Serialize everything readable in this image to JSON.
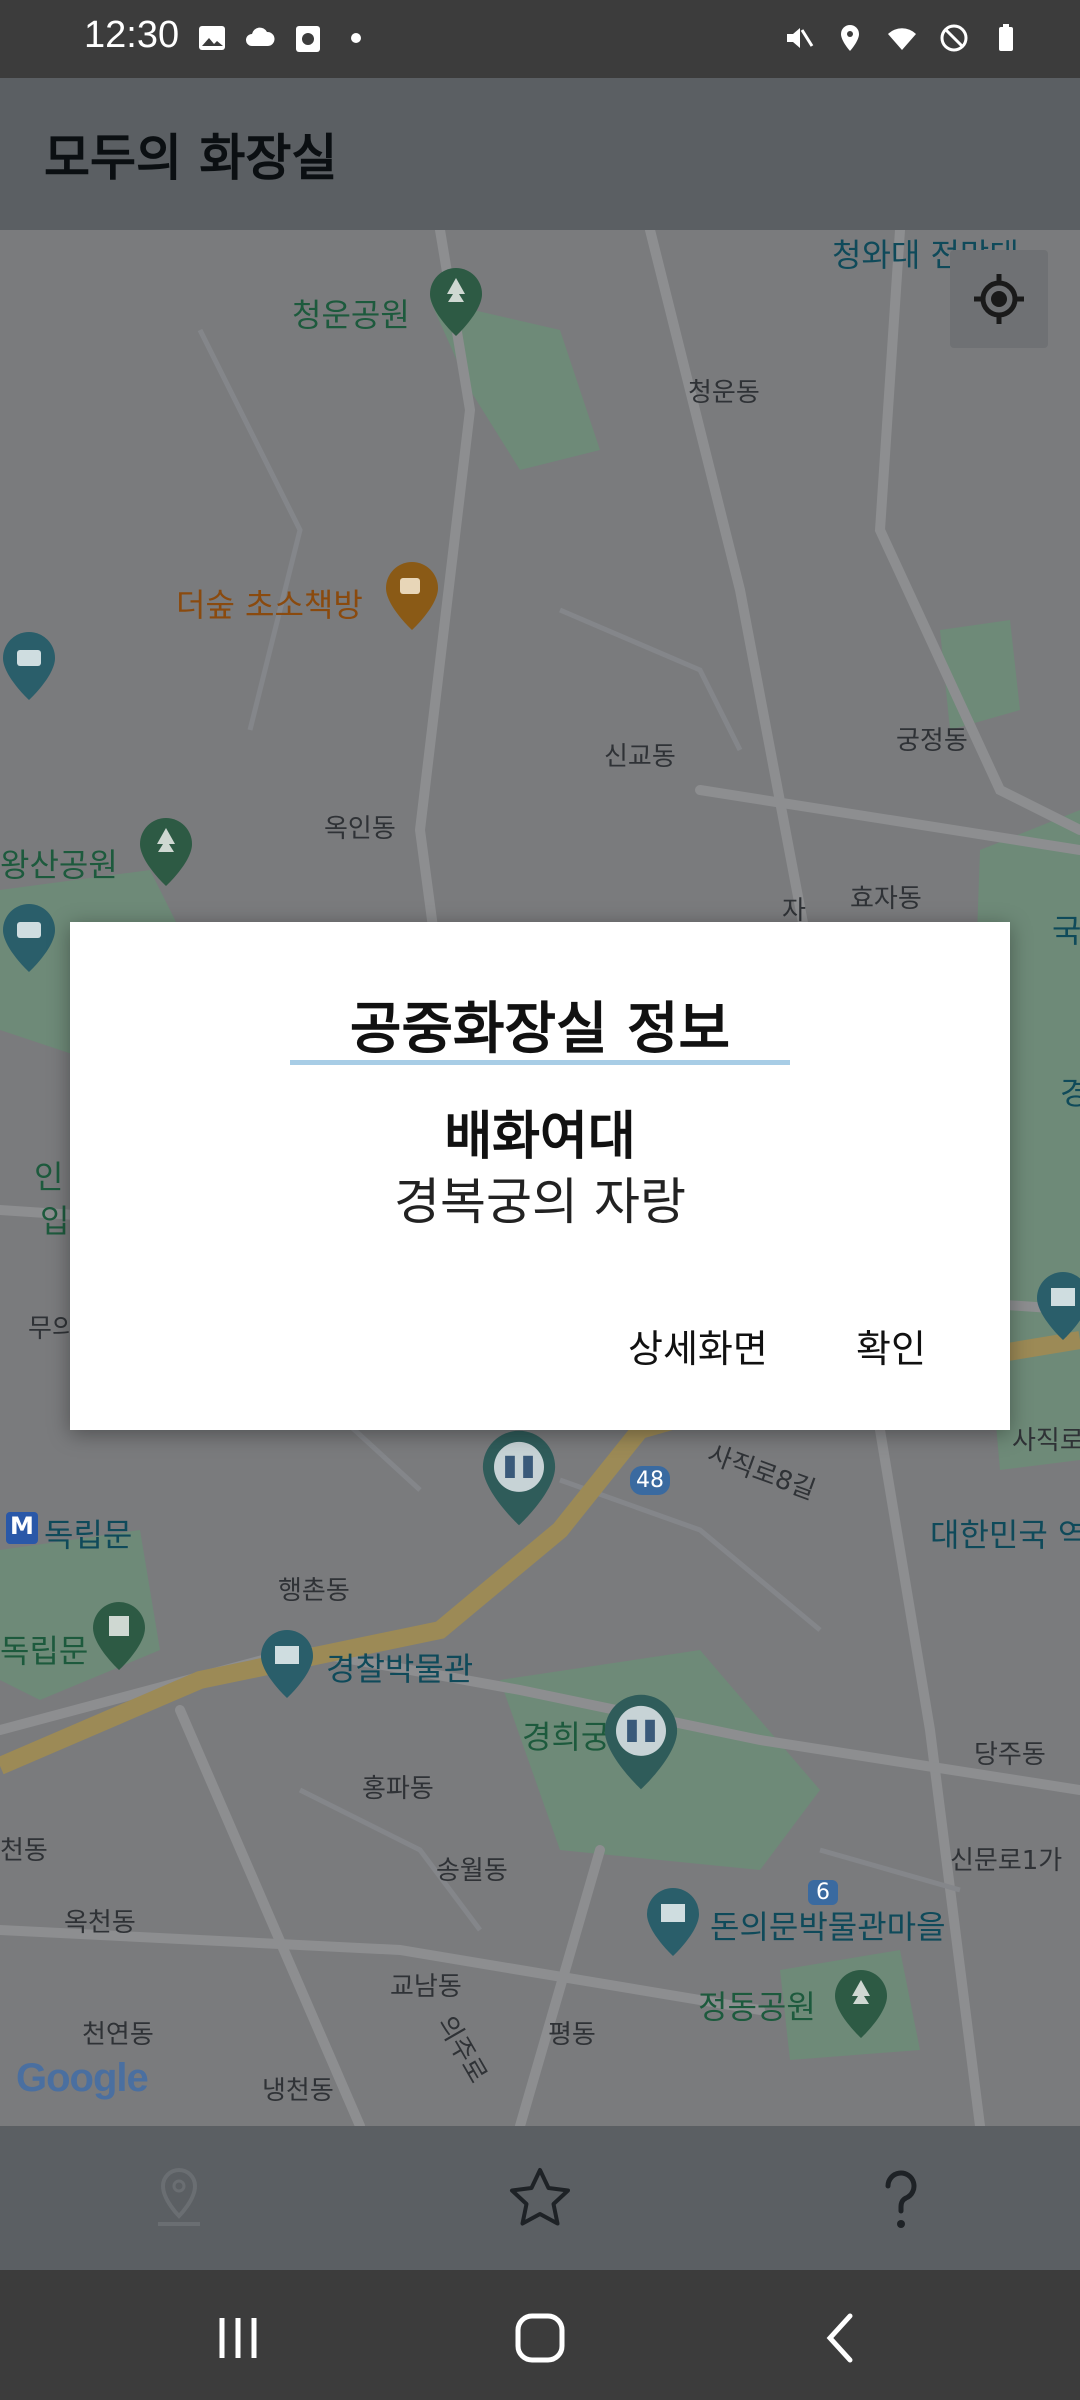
{
  "status_bar": {
    "time": "12:30"
  },
  "app_bar": {
    "title": "모두의 화장실"
  },
  "map": {
    "labels": {
      "cheongwadae": "청와대 전망대",
      "cheongungongwon": "청운공원",
      "cheongundong": "청운동",
      "deosup": "더숲 초소책방",
      "singyodong": "신교동",
      "gungjeongdong": "궁정동",
      "okindong": "옥인동",
      "wangsangongwon": "왕산공원",
      "hyojadong": "효자동",
      "in": "인",
      "ip": "입",
      "mu": "무의",
      "dongnipmun_station": "독립문",
      "dongnipmun": "독립문",
      "sajikro8gil": "사직로8길",
      "sajikro": "사직로",
      "daehanminguk": "대한민국 역",
      "haengchondong": "행촌동",
      "police_museum": "경찰박물관",
      "gyeonghuigung": "경희궁",
      "dangjudong": "당주동",
      "hongpadong": "홍파동",
      "cheondong": "천동",
      "songwoldong": "송월동",
      "sinmunro": "신문로1가",
      "okcheondong": "옥천동",
      "donuimun": "돈의문박물관마을",
      "gyonamdong": "교남동",
      "jeongdonggongwon": "정동공원",
      "cheonyeondong": "천연동",
      "pyeongdong": "평동",
      "naengcheondong": "냉천동",
      "road48": "48",
      "road6": "6",
      "eunjuro": "의주로",
      "ja": "자",
      "guk": "국",
      "gyeong": "경"
    },
    "google": "Google"
  },
  "dialog": {
    "title": "공중화장실 정보",
    "name": "배화여대",
    "description": "경복궁의 자랑",
    "detail_button": "상세화면",
    "confirm_button": "확인"
  }
}
